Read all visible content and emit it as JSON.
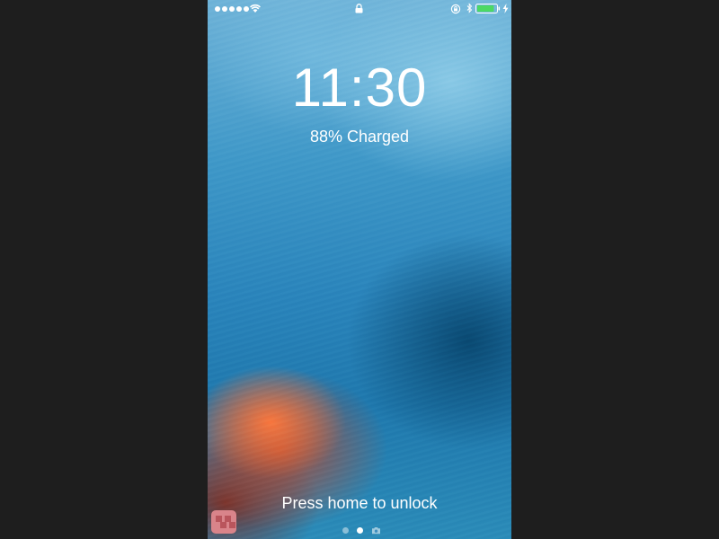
{
  "lock_screen": {
    "time": "11:30",
    "charge_status": "88% Charged",
    "unlock_hint": "Press home to unlock"
  },
  "status_bar": {
    "signal_bars": 5,
    "battery_level": 0.88,
    "battery_color": "#4cd964",
    "icons": [
      "signal-dots",
      "wifi-icon",
      "lock-icon",
      "rotation-lock-icon",
      "bluetooth-icon",
      "battery-icon",
      "charging-icon"
    ]
  },
  "page_indicator": {
    "pages": [
      "search",
      "lock",
      "camera"
    ],
    "active_index": 1
  }
}
